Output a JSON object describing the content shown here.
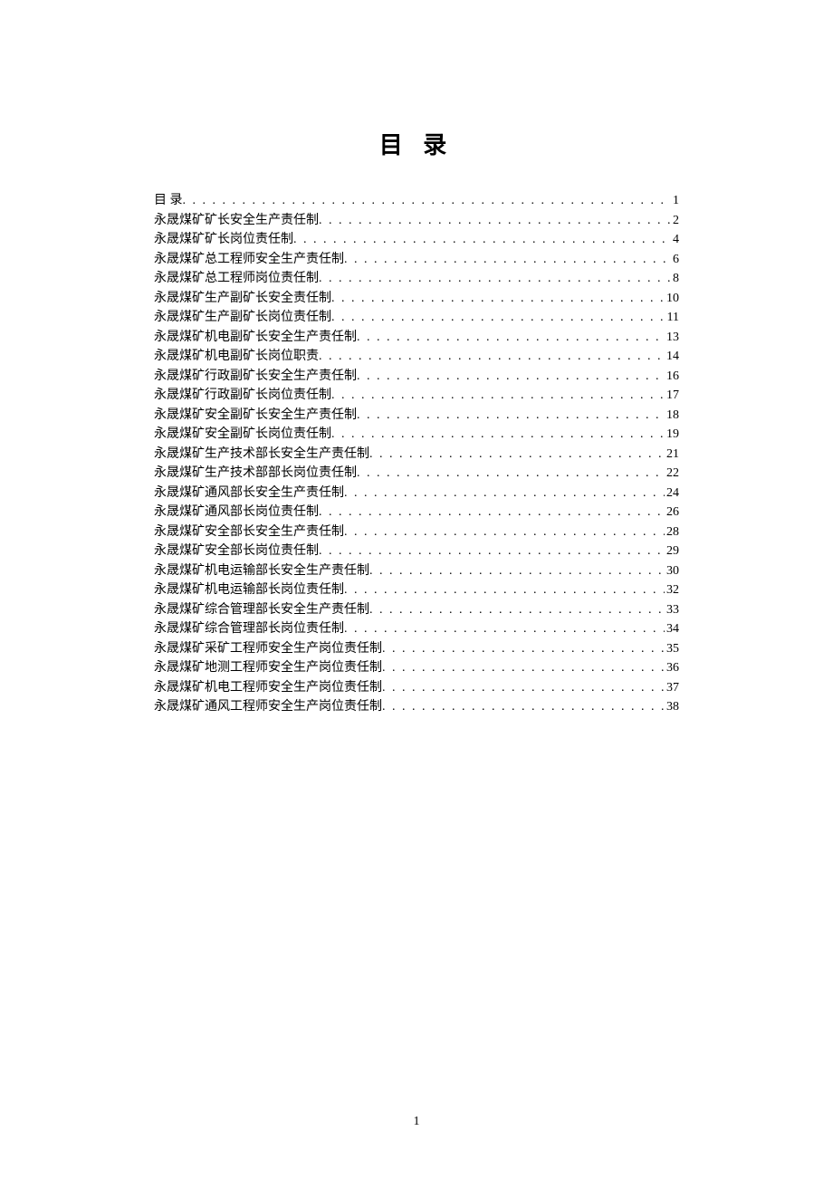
{
  "title": "目 录",
  "page_number": "1",
  "toc": [
    {
      "label": "目 录",
      "page": "1"
    },
    {
      "label": "永晟煤矿矿长安全生产责任制",
      "page": "2"
    },
    {
      "label": "永晟煤矿矿长岗位责任制",
      "page": "4"
    },
    {
      "label": "永晟煤矿总工程师安全生产责任制",
      "page": "6"
    },
    {
      "label": "永晟煤矿总工程师岗位责任制",
      "page": "8"
    },
    {
      "label": "永晟煤矿生产副矿长安全责任制",
      "page": "10"
    },
    {
      "label": "永晟煤矿生产副矿长岗位责任制",
      "page": "11"
    },
    {
      "label": "永晟煤矿机电副矿长安全生产责任制",
      "page": "13"
    },
    {
      "label": "永晟煤矿机电副矿长岗位职责",
      "page": "14"
    },
    {
      "label": "永晟煤矿行政副矿长安全生产责任制",
      "page": "16"
    },
    {
      "label": "永晟煤矿行政副矿长岗位责任制",
      "page": "17"
    },
    {
      "label": "永晟煤矿安全副矿长安全生产责任制",
      "page": "18"
    },
    {
      "label": "永晟煤矿安全副矿长岗位责任制",
      "page": "19"
    },
    {
      "label": "永晟煤矿生产技术部长安全生产责任制",
      "page": "21"
    },
    {
      "label": "永晟煤矿生产技术部部长岗位责任制",
      "page": "22"
    },
    {
      "label": "永晟煤矿通风部长安全生产责任制",
      "page": "24"
    },
    {
      "label": "永晟煤矿通风部长岗位责任制",
      "page": "26"
    },
    {
      "label": "永晟煤矿安全部长安全生产责任制",
      "page": "28"
    },
    {
      "label": "永晟煤矿安全部长岗位责任制",
      "page": "29"
    },
    {
      "label": "永晟煤矿机电运输部长安全生产责任制",
      "page": "30"
    },
    {
      "label": "永晟煤矿机电运输部长岗位责任制",
      "page": "32"
    },
    {
      "label": "永晟煤矿综合管理部长安全生产责任制",
      "page": "33"
    },
    {
      "label": "永晟煤矿综合管理部长岗位责任制",
      "page": "34"
    },
    {
      "label": "永晟煤矿采矿工程师安全生产岗位责任制",
      "page": "35"
    },
    {
      "label": "永晟煤矿地测工程师安全生产岗位责任制",
      "page": "36"
    },
    {
      "label": "永晟煤矿机电工程师安全生产岗位责任制",
      "page": "37"
    },
    {
      "label": "永晟煤矿通风工程师安全生产岗位责任制",
      "page": "38"
    }
  ]
}
